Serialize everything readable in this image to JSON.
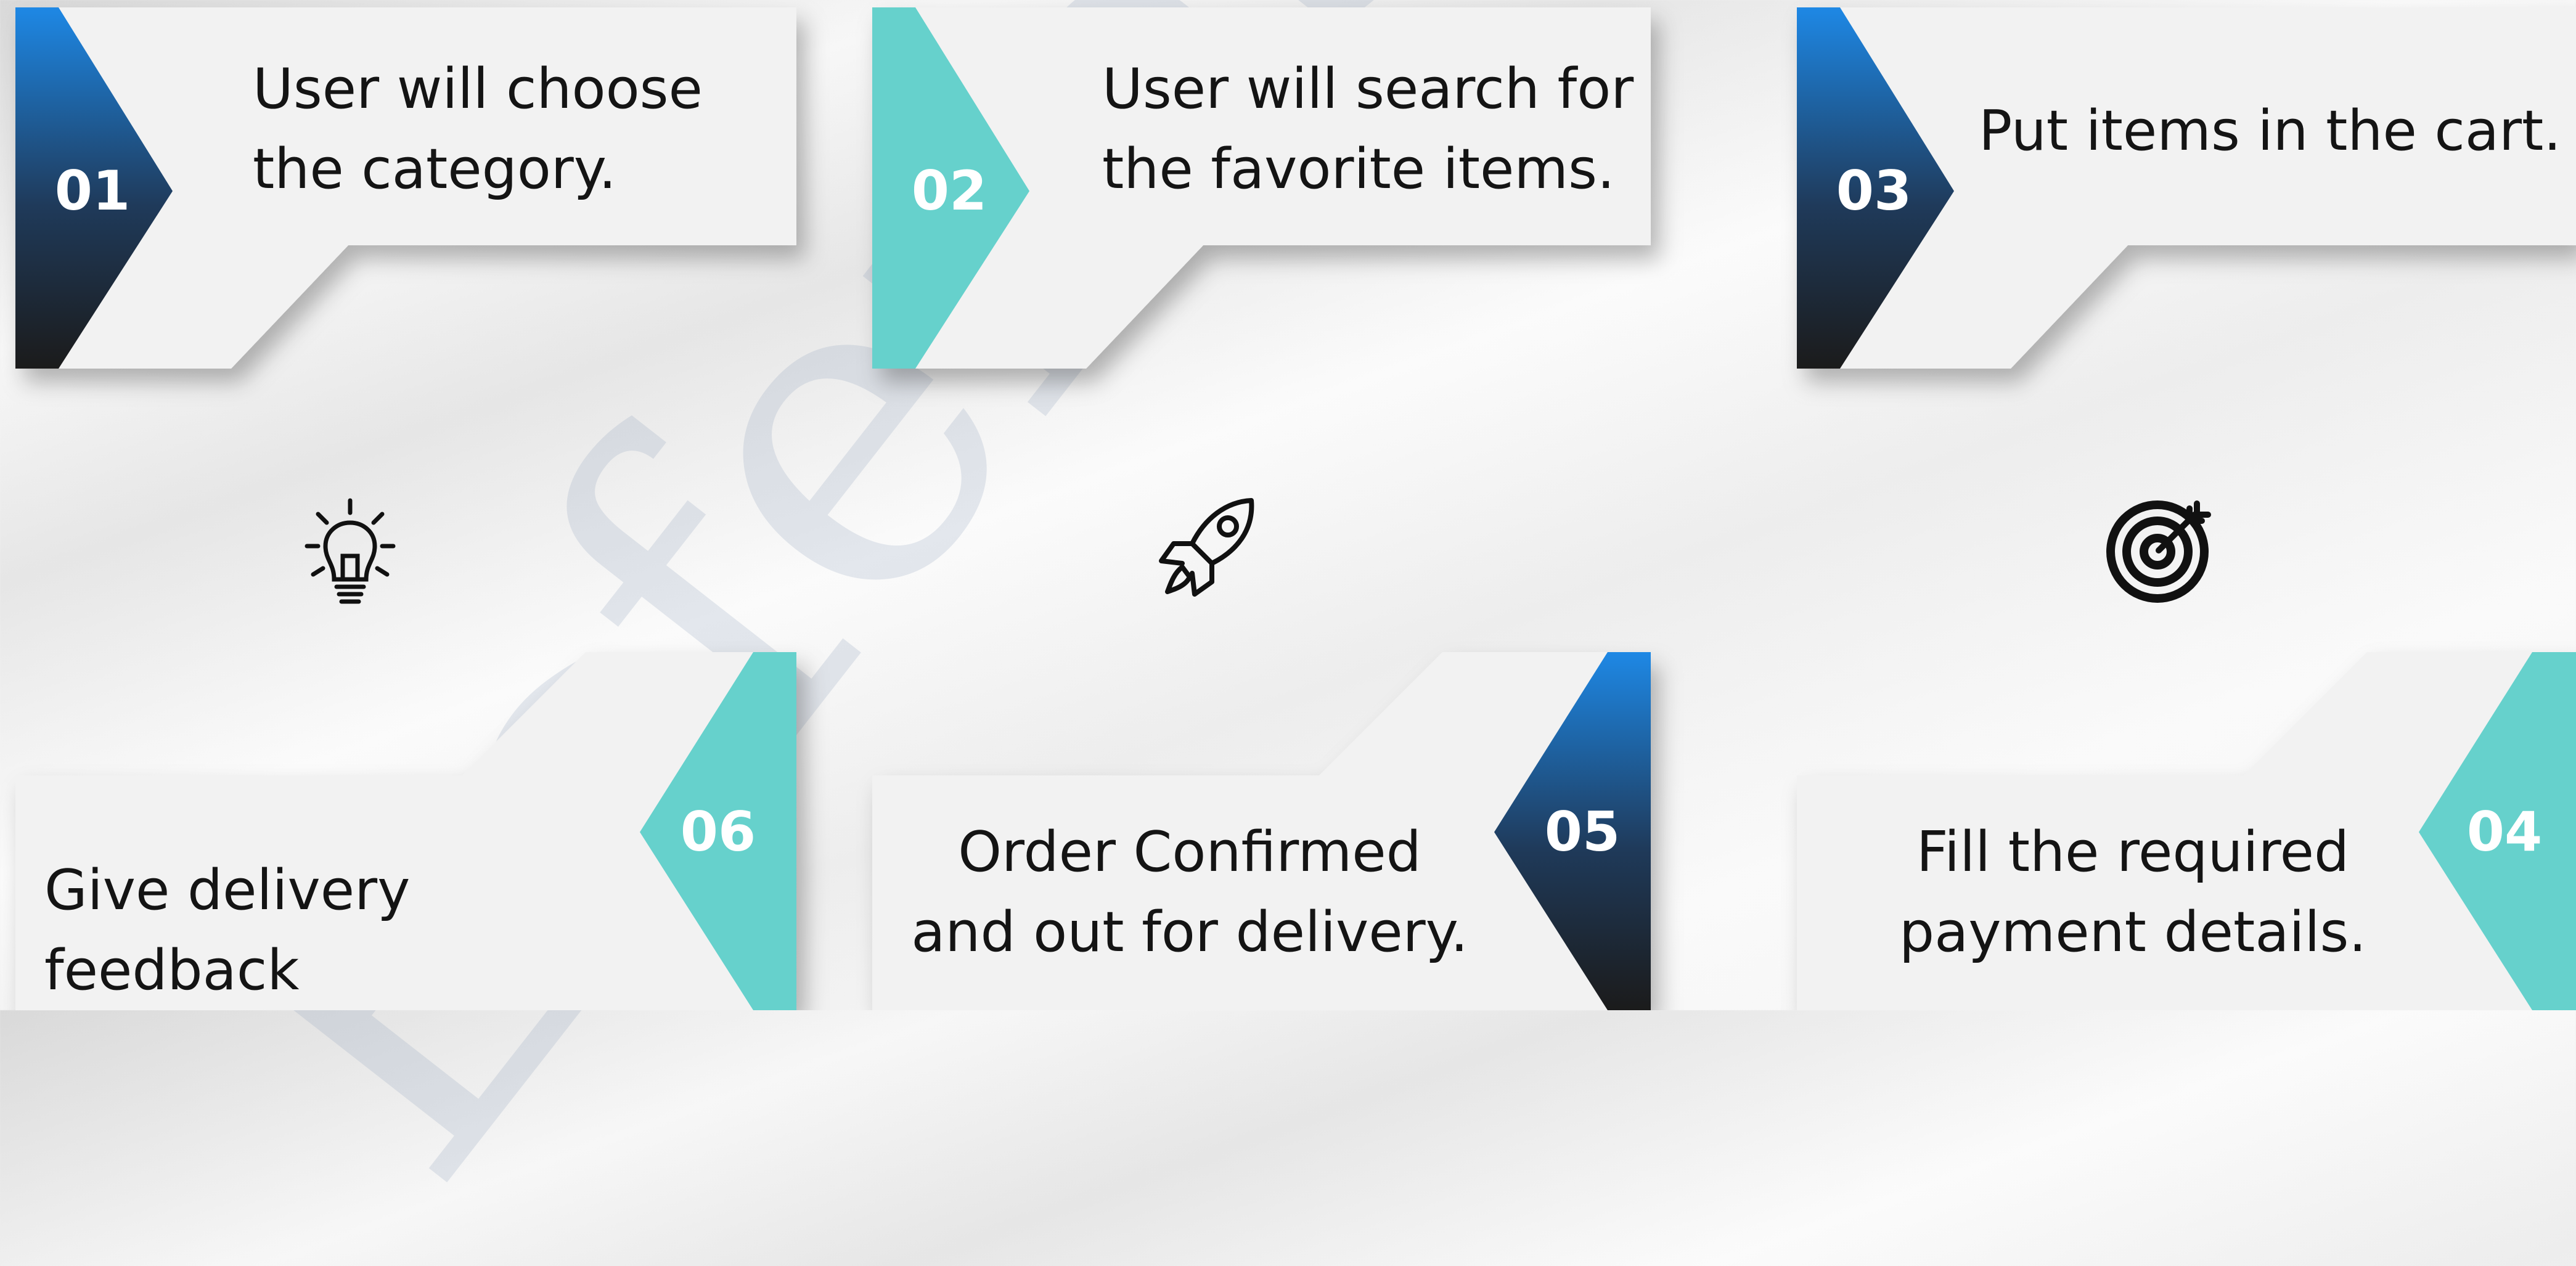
{
  "watermark": "Esferaso",
  "colors": {
    "navy": "#1f3a5a",
    "blue": "#1e88e5",
    "teal": "#66d1cc",
    "card": "#f2f2f2",
    "text": "#141414"
  },
  "steps": [
    {
      "number": "01",
      "line1": "User will choose",
      "line2": "the category.",
      "accent": "navy"
    },
    {
      "number": "02",
      "line1": "User will search for",
      "line2": "the favorite items.",
      "accent": "teal"
    },
    {
      "number": "03",
      "line1": "Put items in the cart.",
      "line2": "",
      "accent": "navy"
    },
    {
      "number": "04",
      "line1": "Fill the required",
      "line2": "payment details.",
      "accent": "teal"
    },
    {
      "number": "05",
      "line1": "Order Confirmed",
      "line2": "and out for delivery.",
      "accent": "navy"
    },
    {
      "number": "06",
      "line1": "Give delivery feedback",
      "line2": "",
      "accent": "teal"
    }
  ],
  "icons": [
    "lightbulb-icon",
    "rocket-icon",
    "target-icon"
  ]
}
